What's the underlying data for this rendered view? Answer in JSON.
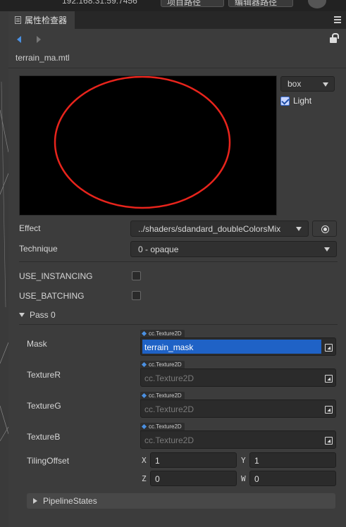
{
  "toolbar": {
    "address": "192.168.31.59:7456",
    "project_button": "项目路径",
    "editor_button": "编辑器路径"
  },
  "panel": {
    "tab_title": "属性检查器",
    "filename": "terrain_ma.mtl"
  },
  "preview": {
    "shape": "box",
    "light_label": "Light",
    "light_checked": true
  },
  "properties": {
    "effect_label": "Effect",
    "effect_value": "../shaders/sdandard_doubleColorsMix",
    "technique_label": "Technique",
    "technique_value": "0 - opaque",
    "use_instancing_label": "USE_INSTANCING",
    "use_batching_label": "USE_BATCHING"
  },
  "pass": {
    "title": "Pass 0",
    "textures": [
      {
        "label": "Mask",
        "type": "cc.Texture2D",
        "value": "terrain_mask"
      },
      {
        "label": "TextureR",
        "type": "cc.Texture2D",
        "value": "cc.Texture2D"
      },
      {
        "label": "TextureG",
        "type": "cc.Texture2D",
        "value": "cc.Texture2D"
      },
      {
        "label": "TextureB",
        "type": "cc.Texture2D",
        "value": "cc.Texture2D"
      }
    ],
    "tiling": {
      "label": "TilingOffset",
      "x_label": "X",
      "x": "1",
      "y_label": "Y",
      "y": "1",
      "z_label": "Z",
      "z": "0",
      "w_label": "W",
      "w": "0"
    },
    "pipeline_label": "PipelineStates"
  },
  "colors": {
    "accent": "#1f62c6",
    "ellipse": "#e8241c"
  }
}
